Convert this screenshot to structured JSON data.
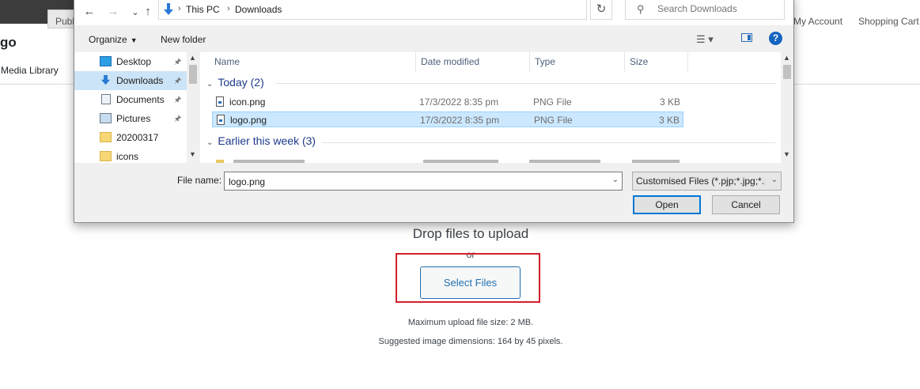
{
  "background": {
    "nav_right": [
      "My Account",
      "Shopping Cart"
    ],
    "nav_left": "Publ",
    "page_title_partial": "go",
    "media_library": "Media Library",
    "drop_text": "Drop files to upload",
    "or_text": "or",
    "select_files": "Select Files",
    "max_upload": "Maximum upload file size: 2 MB.",
    "suggested_dims": "Suggested image dimensions: 164 by 45 pixels.",
    "highlight_color": "#d21f2b"
  },
  "dialog": {
    "address": {
      "crumbs": [
        "This PC",
        "Downloads"
      ]
    },
    "search_placeholder": "Search Downloads",
    "toolbar": {
      "organize": "Organize",
      "new_folder": "New folder",
      "help": "?"
    },
    "nav_items": [
      {
        "label": "Desktop",
        "icon": "desktop-icon",
        "pinned": true,
        "selected": false
      },
      {
        "label": "Downloads",
        "icon": "downloads-icon",
        "pinned": true,
        "selected": true
      },
      {
        "label": "Documents",
        "icon": "documents-icon",
        "pinned": true,
        "selected": false
      },
      {
        "label": "Pictures",
        "icon": "pictures-icon",
        "pinned": true,
        "selected": false
      },
      {
        "label": "20200317",
        "icon": "folder-icon",
        "pinned": false,
        "selected": false
      },
      {
        "label": "icons",
        "icon": "folder-check-icon",
        "pinned": false,
        "selected": false
      }
    ],
    "columns": [
      "Name",
      "Date modified",
      "Type",
      "Size"
    ],
    "groups": [
      {
        "label": "Today (2)",
        "files": [
          {
            "name": "icon.png",
            "date": "17/3/2022 8:35 pm",
            "type": "PNG File",
            "size": "3 KB",
            "selected": false
          },
          {
            "name": "logo.png",
            "date": "17/3/2022 8:35 pm",
            "type": "PNG File",
            "size": "3 KB",
            "selected": true
          }
        ]
      },
      {
        "label": "Earlier this week (3)",
        "files": []
      }
    ],
    "file_name_label": "File name:",
    "file_name_value": "logo.png",
    "file_type_filter": "Customised Files (*.pjp;*.jpg;*.pjpeg;*.jpeg;*.jfif;*.png;*.gif)",
    "open_button": "Open",
    "cancel_button": "Cancel",
    "accent_color": "#0078d7"
  }
}
